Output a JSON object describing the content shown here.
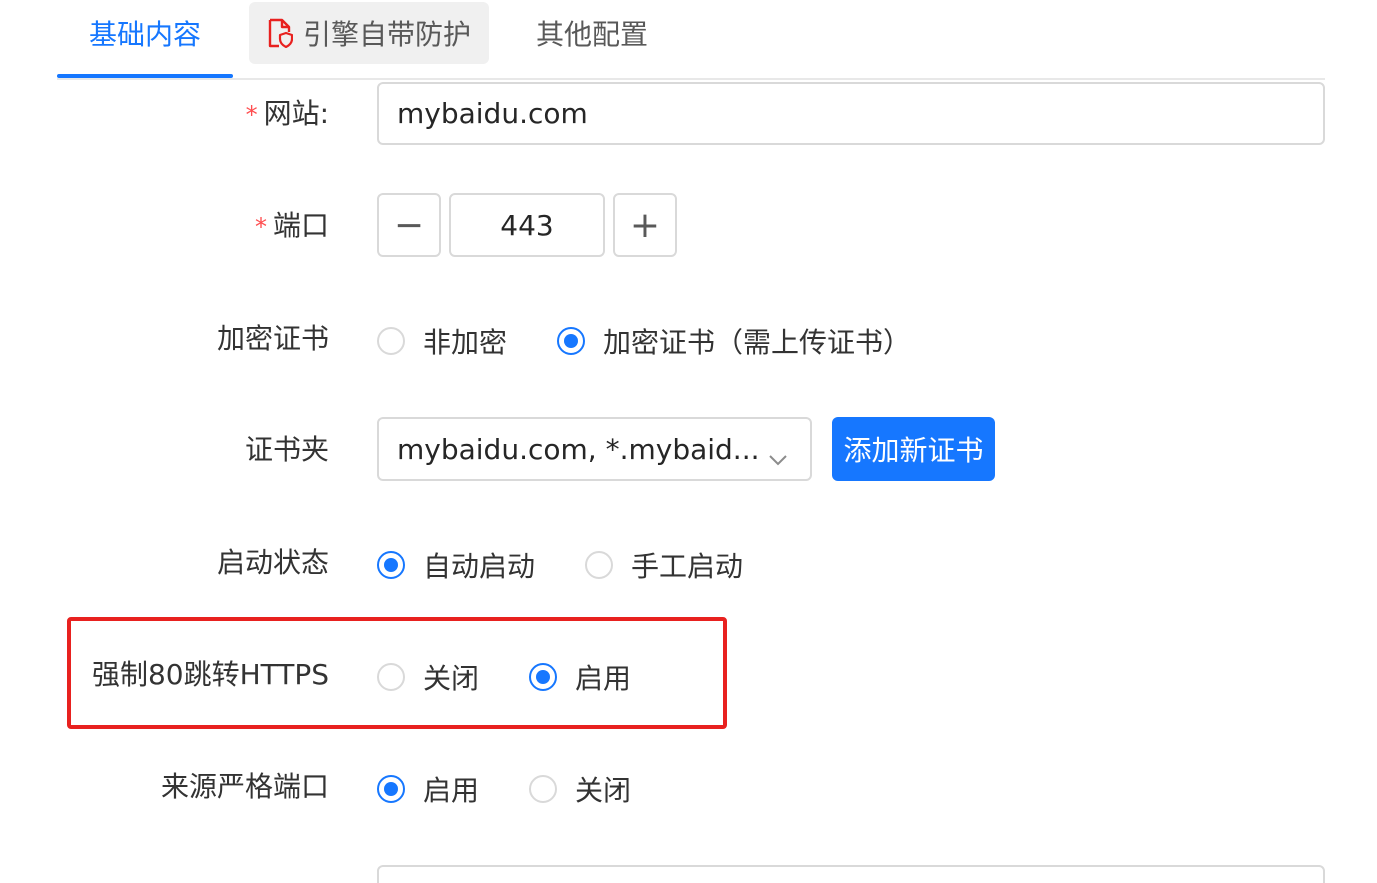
{
  "tabs": [
    {
      "label": "基础内容"
    },
    {
      "label": "引擎自带防护"
    },
    {
      "label": "其他配置"
    }
  ],
  "form": {
    "site": {
      "label": "网站:",
      "value": "mybaidu.com"
    },
    "port": {
      "label": "端口",
      "value": "443",
      "minus": "−",
      "plus": "+"
    },
    "encryption": {
      "label": "加密证书",
      "options": [
        {
          "label": "非加密",
          "checked": false
        },
        {
          "label": "加密证书（需上传证书）",
          "checked": true
        }
      ]
    },
    "cert_folder": {
      "label": "证书夹",
      "value": "mybaidu.com, *.mybaid...",
      "add_button": "添加新证书"
    },
    "start_status": {
      "label": "启动状态",
      "options": [
        {
          "label": "自动启动",
          "checked": true
        },
        {
          "label": "手工启动",
          "checked": false
        }
      ]
    },
    "force_https": {
      "label": "强制80跳转HTTPS",
      "options": [
        {
          "label": "关闭",
          "checked": false
        },
        {
          "label": "启用",
          "checked": true
        }
      ]
    },
    "strict_port": {
      "label": "来源严格端口",
      "options": [
        {
          "label": "启用",
          "checked": true
        },
        {
          "label": "关闭",
          "checked": false
        }
      ]
    }
  },
  "colors": {
    "primary": "#1677ff",
    "highlight": "#e8211f",
    "required": "#ff4d4f"
  },
  "icons": {
    "tab_icon": "document-shield-icon",
    "select_arrow": "chevron-down-icon"
  }
}
